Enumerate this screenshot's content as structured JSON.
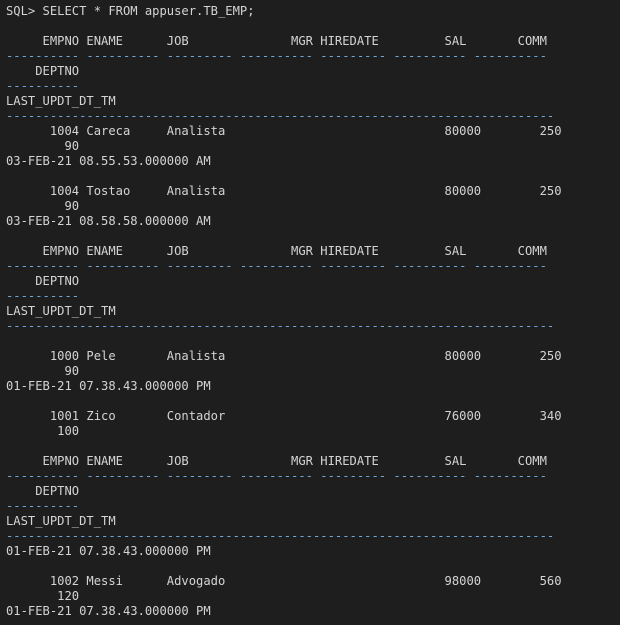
{
  "terminal": {
    "prompt": "SQL> ",
    "command": "SELECT * FROM appuser.TB_EMP;",
    "lines": [
      {
        "t": "SQL> SELECT * FROM appuser.TB_EMP;"
      },
      {
        "t": ""
      },
      {
        "t": "     EMPNO ENAME      JOB              MGR HIREDATE         SAL       COMM"
      },
      {
        "t": "---------- ---------- --------- ---------- --------- ---------- ----------",
        "d": true
      },
      {
        "t": "    DEPTNO"
      },
      {
        "t": "----------",
        "d": true
      },
      {
        "t": "LAST_UPDT_DT_TM"
      },
      {
        "t": "---------------------------------------------------------------------------",
        "d": true
      },
      {
        "t": "      1004 Careca     Analista                              80000        250"
      },
      {
        "t": "        90"
      },
      {
        "t": "03-FEB-21 08.55.53.000000 AM"
      },
      {
        "t": ""
      },
      {
        "t": "      1004 Tostao     Analista                              80000        250"
      },
      {
        "t": "        90"
      },
      {
        "t": "03-FEB-21 08.58.58.000000 AM"
      },
      {
        "t": ""
      },
      {
        "t": "     EMPNO ENAME      JOB              MGR HIREDATE         SAL       COMM"
      },
      {
        "t": "---------- ---------- --------- ---------- --------- ---------- ----------",
        "d": true
      },
      {
        "t": "    DEPTNO"
      },
      {
        "t": "----------",
        "d": true
      },
      {
        "t": "LAST_UPDT_DT_TM"
      },
      {
        "t": "---------------------------------------------------------------------------",
        "d": true
      },
      {
        "t": ""
      },
      {
        "t": "      1000 Pele       Analista                              80000        250"
      },
      {
        "t": "        90"
      },
      {
        "t": "01-FEB-21 07.38.43.000000 PM"
      },
      {
        "t": ""
      },
      {
        "t": "      1001 Zico       Contador                              76000        340"
      },
      {
        "t": "       100"
      },
      {
        "t": ""
      },
      {
        "t": "     EMPNO ENAME      JOB              MGR HIREDATE         SAL       COMM"
      },
      {
        "t": "---------- ---------- --------- ---------- --------- ---------- ----------",
        "d": true
      },
      {
        "t": "    DEPTNO"
      },
      {
        "t": "----------",
        "d": true
      },
      {
        "t": "LAST_UPDT_DT_TM"
      },
      {
        "t": "---------------------------------------------------------------------------",
        "d": true
      },
      {
        "t": "01-FEB-21 07.38.43.000000 PM"
      },
      {
        "t": ""
      },
      {
        "t": "      1002 Messi      Advogado                              98000        560"
      },
      {
        "t": "       120"
      },
      {
        "t": "01-FEB-21 07.38.43.000000 PM"
      }
    ]
  },
  "colors": {
    "background": "#1e1e1e",
    "text": "#d4d4d4",
    "separator": "#6fa8dc"
  }
}
